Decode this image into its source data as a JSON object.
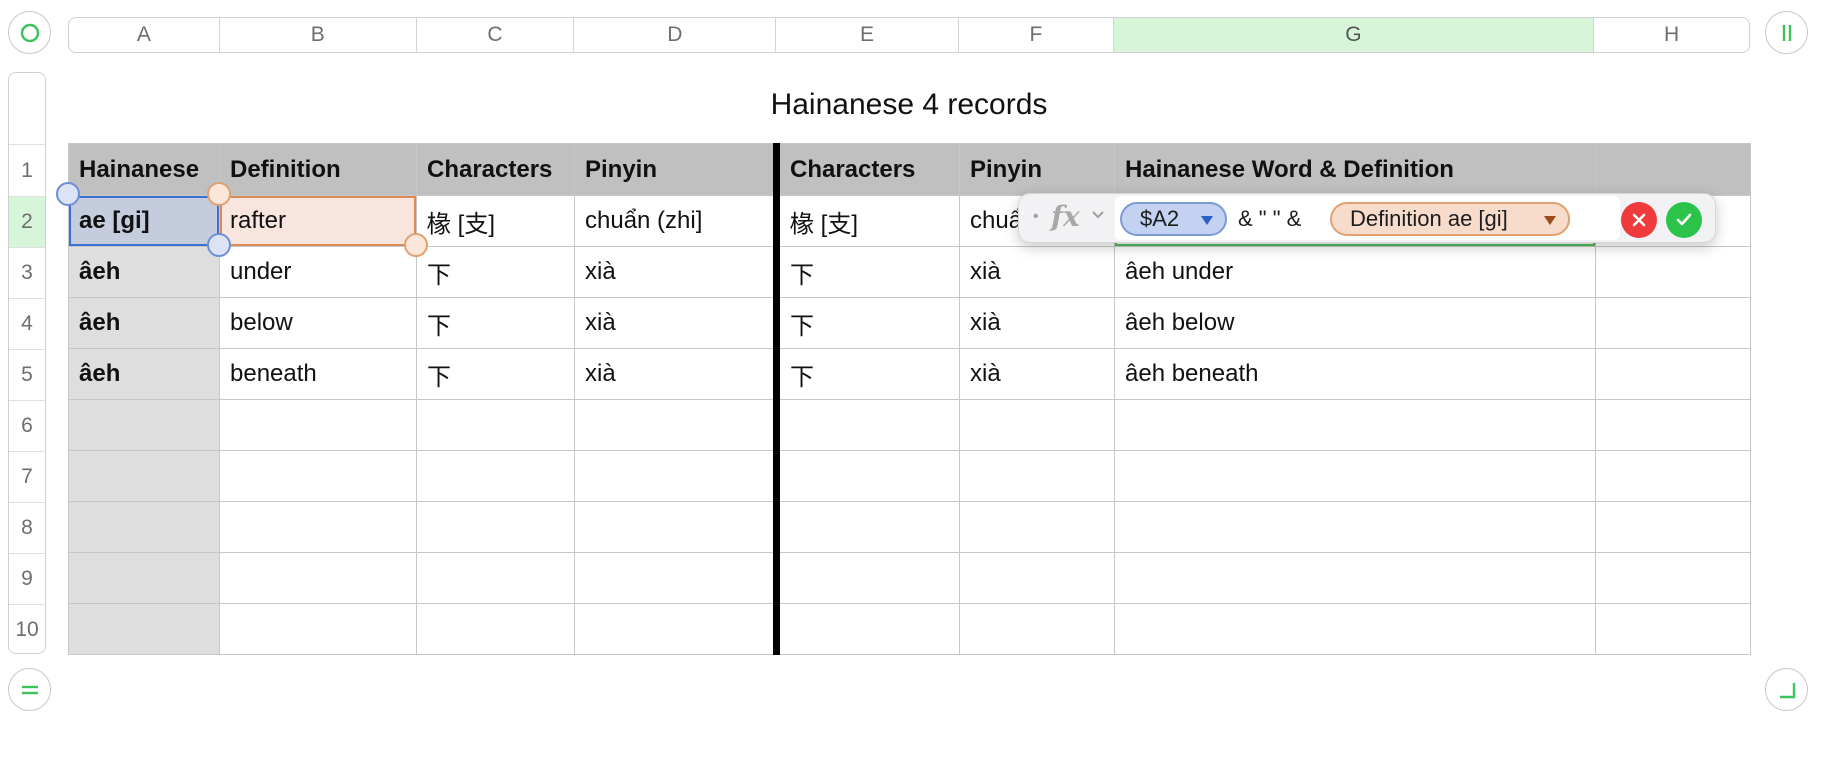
{
  "title": "Hainanese 4 records",
  "columns": [
    "A",
    "B",
    "C",
    "D",
    "E",
    "F",
    "G",
    "H"
  ],
  "selected_column": "G",
  "rows": [
    "1",
    "2",
    "3",
    "4",
    "5",
    "6",
    "7",
    "8",
    "9",
    "10"
  ],
  "selected_row": "2",
  "table": {
    "header": [
      "Hainanese",
      "Definition",
      "Characters",
      "Pinyin",
      "Characters",
      "Pinyin",
      "Hainanese Word & Definition",
      ""
    ],
    "body": [
      [
        "ae [gi]",
        "rafter",
        "椽 [支]",
        "chuẩn (zhi]",
        "椽 [支]",
        "chuẩ",
        "",
        ""
      ],
      [
        "âeh",
        "under",
        "下",
        "xià",
        "下",
        "xià",
        "âeh under",
        ""
      ],
      [
        "âeh",
        "below",
        "下",
        "xià",
        "下",
        "xià",
        "âeh below",
        ""
      ],
      [
        "âeh",
        "beneath",
        "下",
        "xià",
        "下",
        "xià",
        "âeh beneath",
        ""
      ],
      [
        "",
        "",
        "",
        "",
        "",
        "",
        "",
        ""
      ],
      [
        "",
        "",
        "",
        "",
        "",
        "",
        "",
        ""
      ],
      [
        "",
        "",
        "",
        "",
        "",
        "",
        "",
        ""
      ],
      [
        "",
        "",
        "",
        "",
        "",
        "",
        "",
        ""
      ],
      [
        "",
        "",
        "",
        "",
        "",
        "",
        "",
        ""
      ]
    ]
  },
  "formula_bar": {
    "fx_label": "fx",
    "token_1": "$A2",
    "operator_text": "& \" \" &",
    "token_2": "Definition ae [gi]"
  },
  "colors": {
    "selection_green": "#d7f5d9",
    "ref_blue": "#c2d2f0",
    "ref_orange": "#f8dccb",
    "cancel_red": "#ef3b3b",
    "accept_green": "#2cc34a"
  }
}
